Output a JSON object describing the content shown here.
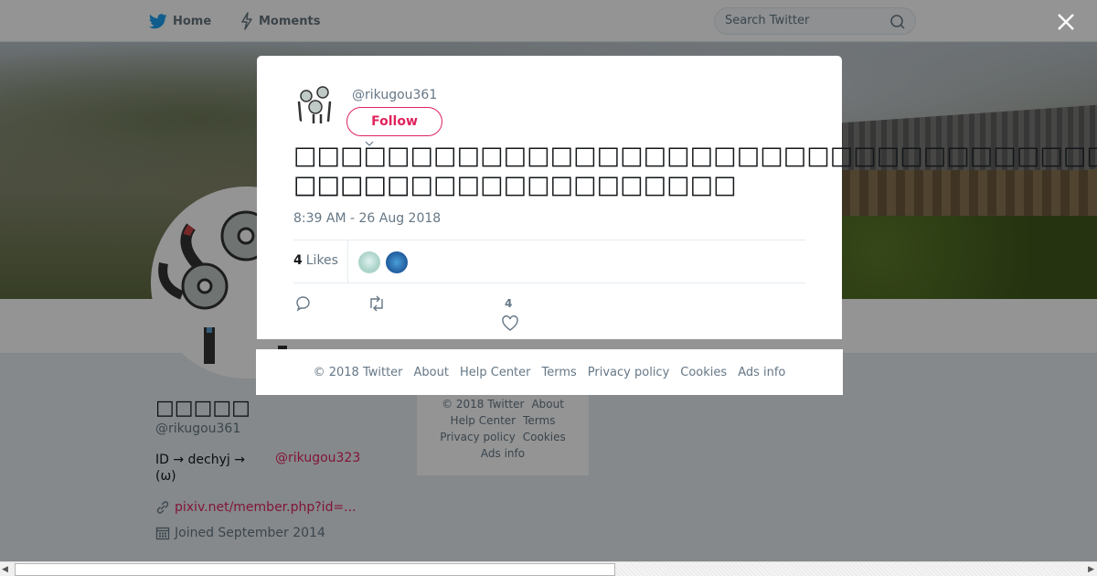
{
  "nav": {
    "home_label": "Home",
    "moments_label": "Moments",
    "search_placeholder": "Search Twitter",
    "brand_color": "#1da1f2"
  },
  "profile": {
    "name": "□□□□□",
    "handle": "@rikugou361",
    "bio_prefix": "ID → dechyj  →",
    "bio_link": "@rikugou323",
    "bio_suffix": "(ω)",
    "url": "pixiv.net/member.php?id=...",
    "joined": "Joined September 2014",
    "accent_color": "#e0245e"
  },
  "side_footer": {
    "line1": [
      "© 2018 Twitter",
      "About"
    ],
    "line2": [
      "Help Center",
      "Terms"
    ],
    "line3": [
      "Privacy policy",
      "Cookies"
    ],
    "line4": [
      "Ads info"
    ]
  },
  "modal": {
    "handle": "@rikugou361",
    "follow_label": "Follow",
    "tweet_line1": "□□□□□□□□□□□□□□□□□□□□□□□□□□□□□□□□□□□□□□□□",
    "tweet_line2": "□□□□□□□□□□□□□□□□□□□",
    "timestamp": "8:39 AM - 26 Aug 2018",
    "likes_count": "4",
    "likes_label": "Likes",
    "like_action_count": "4"
  },
  "modal_footer": {
    "items": [
      "© 2018 Twitter",
      "About",
      "Help Center",
      "Terms",
      "Privacy policy",
      "Cookies",
      "Ads info"
    ]
  }
}
